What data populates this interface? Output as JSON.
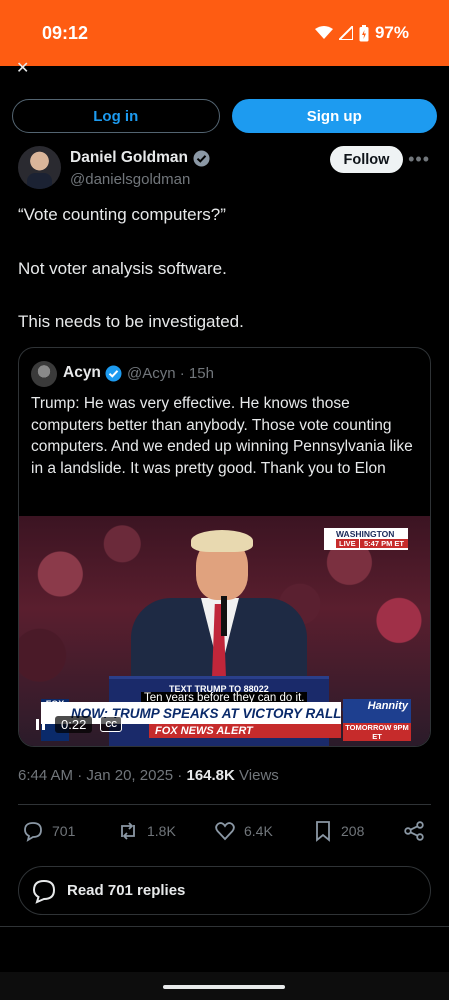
{
  "status_bar": {
    "time": "09:12",
    "battery": "97%"
  },
  "auth": {
    "login_label": "Log in",
    "signup_label": "Sign up"
  },
  "author": {
    "name": "Daniel Goldman",
    "handle": "@danielsgoldman",
    "follow_label": "Follow"
  },
  "tweet": {
    "lines": [
      "“Vote counting computers?”",
      "Not voter analysis software.",
      "This needs to be investigated."
    ]
  },
  "quote": {
    "name": "Acyn",
    "handle": "@Acyn",
    "age": "15h",
    "text": "Trump: He was very effective. He knows those computers better than anybody. Those vote counting computers. And we ended up winning Pennsylvania like in a landslide. It was pretty good. Thank you to Elon",
    "video": {
      "live_location": "WASHINGTON",
      "live_label": "LIVE",
      "live_time": "5:47 PM ET",
      "chyron": "NOW: TRUMP SPEAKS AT VICTORY RALLY IN DC",
      "alert": "FOX NEWS ALERT",
      "sign_text": "TEXT TRUMP TO 88022",
      "caption": "Ten years before they can do it.",
      "promo_title": "Hannity",
      "promo_bottom": "TOMORROW 9PM ET",
      "elapsed": "0:22",
      "cc_label": "CC"
    }
  },
  "meta": {
    "time": "6:44 AM",
    "date": "Jan 20, 2025",
    "views_count": "164.8K",
    "views_label": "Views"
  },
  "actions": {
    "replies": "701",
    "reposts": "1.8K",
    "likes": "6.4K",
    "bookmarks": "208"
  },
  "read_replies_label": "Read 701 replies",
  "colors": {
    "status_bar": "#fe5c12",
    "accent": "#1d9bf0",
    "background": "#000000"
  }
}
